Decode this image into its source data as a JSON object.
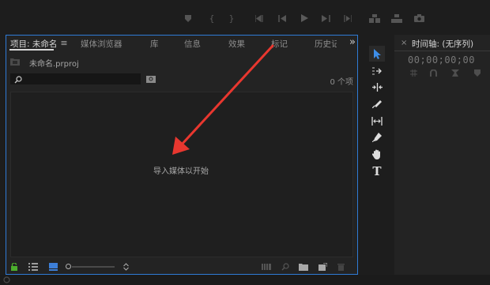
{
  "project_panel": {
    "tabs": [
      {
        "label": "项目: 未命名",
        "active": true
      },
      {
        "label": "媒体浏览器"
      },
      {
        "label": "库"
      },
      {
        "label": "信息"
      },
      {
        "label": "效果"
      },
      {
        "label": "标记"
      },
      {
        "label": "历史记"
      }
    ],
    "overflow_label": "»",
    "file_name": "未命名.prproj",
    "search_value": "",
    "item_count": "0 个项",
    "empty_message": "导入媒体以开始"
  },
  "timeline_panel": {
    "title": "时间轴: (无序列)",
    "timecode": "00;00;00;00"
  },
  "colors": {
    "accent_blue": "#2f7bd6",
    "lock_green": "#4caf2d",
    "arrow_red": "#e8372f"
  }
}
